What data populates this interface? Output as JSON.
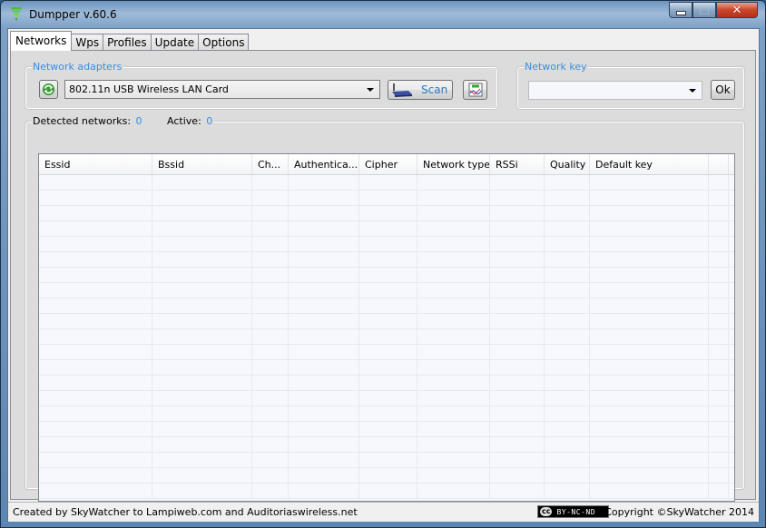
{
  "window": {
    "title": "Dumpper v.60.6",
    "controls": {
      "minimize": "minimize",
      "maximize": "maximize",
      "close": "close"
    }
  },
  "tabs": [
    {
      "label": "Networks",
      "active": true
    },
    {
      "label": "Wps",
      "active": false
    },
    {
      "label": "Profiles",
      "active": false
    },
    {
      "label": "Update",
      "active": false
    },
    {
      "label": "Options",
      "active": false
    }
  ],
  "adapters": {
    "group_label": "Network adapters",
    "selected_adapter": "802.11n USB Wireless LAN Card",
    "refresh_icon": "refresh-icon",
    "scan_label": "Scan",
    "scan_icon": "router-icon",
    "monitor_icon": "monitor-chart-icon"
  },
  "network_key": {
    "group_label": "Network key",
    "value": "",
    "ok_label": "Ok"
  },
  "summary": {
    "detected_label": "Detected networks:",
    "detected_value": "0",
    "active_label": "Active:",
    "active_value": "0"
  },
  "table": {
    "columns": [
      "Essid",
      "Bssid",
      "Ch...",
      "Authentica...",
      "Cipher",
      "Network type",
      "RSSi",
      "Quality",
      "Default key"
    ],
    "rows": []
  },
  "status": {
    "credits": "Created by SkyWatcher to Lampiweb.com and Auditoriaswireless.net",
    "license_cc": "cc",
    "license_text": "BY-NC-ND",
    "copyright": "Copyright ©SkyWatcher 2014"
  }
}
